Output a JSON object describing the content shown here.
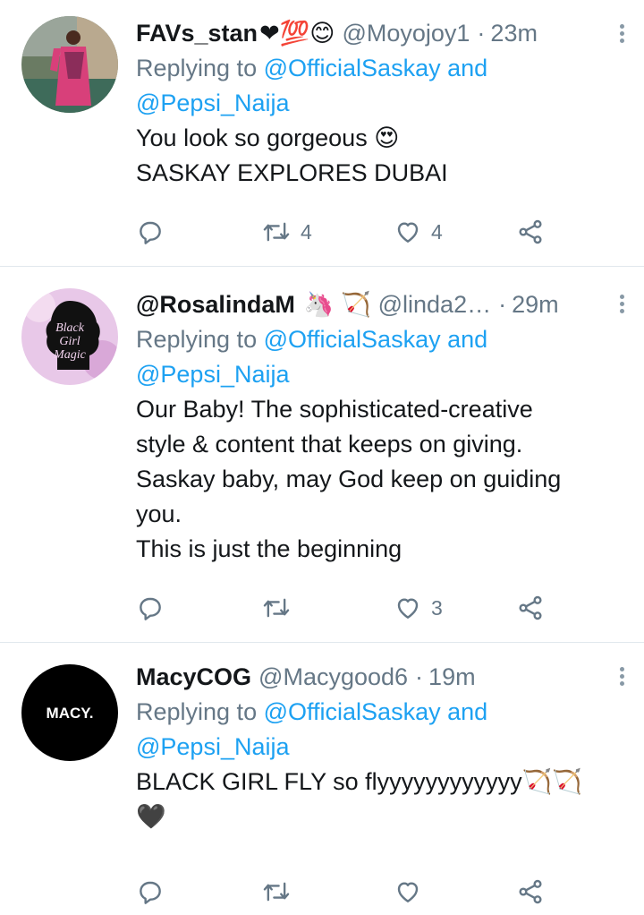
{
  "tweets": [
    {
      "name": "FAVs_stan",
      "name_emoji": "❤💯😊",
      "handle": "@Moyojoy1",
      "time": "23m",
      "replying_prefix": "Replying to",
      "replying_to_1": "@OfficialSaskay",
      "replying_and": "and",
      "replying_to_2": "@Pepsi_Naija",
      "text": "You look so gorgeous 😍\nSASKAY EXPLORES DUBAI",
      "retweets": "4",
      "likes": "4"
    },
    {
      "name": "@RosalindaM",
      "name_emoji": "🦄 🏹",
      "handle": "@linda2…",
      "time": "29m",
      "replying_prefix": "Replying to",
      "replying_to_1": "@OfficialSaskay",
      "replying_and": "and",
      "replying_to_2": "@Pepsi_Naija",
      "text": "Our Baby! The sophisticated-creative\nstyle & content that keeps on giving.\nSaskay baby, may God keep on guiding\nyou.\nThis is just the beginning",
      "retweets": "",
      "likes": "3",
      "avatar_text": "Black Girl Magic"
    },
    {
      "name": "MacyCOG",
      "name_emoji": "",
      "handle": "@Macygood6",
      "time": "19m",
      "replying_prefix": "Replying to",
      "replying_to_1": "@OfficialSaskay",
      "replying_and": "and",
      "replying_to_2": "@Pepsi_Naija",
      "text": "BLACK GIRL FLY so flyyyyyyyyyyyy🏹🏹\n🖤",
      "retweets": "",
      "likes": "",
      "avatar_text": "MACY."
    }
  ],
  "colors": {
    "link": "#1da1f2",
    "secondary": "#657786",
    "divider": "#e1e8ed"
  },
  "icons": [
    "reply-icon",
    "retweet-icon",
    "like-icon",
    "share-icon",
    "more-options-icon"
  ]
}
